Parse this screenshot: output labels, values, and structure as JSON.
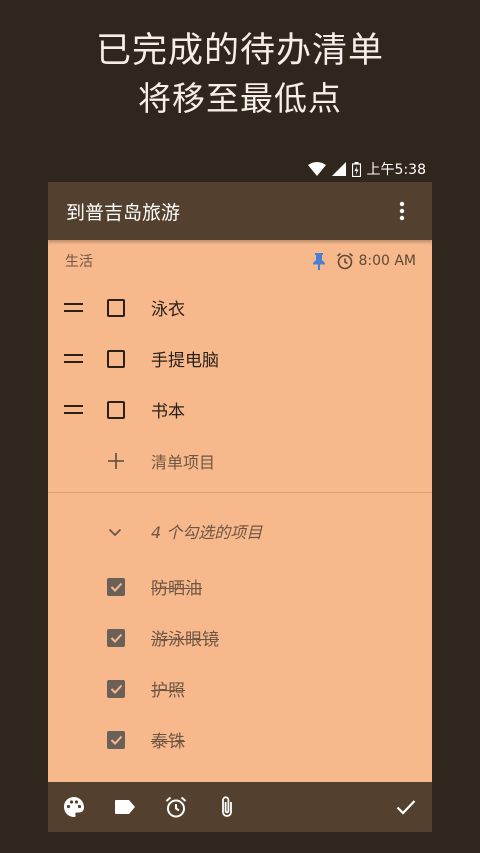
{
  "promo": {
    "line1": "已完成的待办清单",
    "line2": "将移至最低点"
  },
  "status_bar": {
    "time": "上午5:38"
  },
  "note": {
    "title": "到普吉岛旅游",
    "label": "生活",
    "reminder_time": "8:00 AM",
    "unchecked_items": [
      {
        "text": "泳衣"
      },
      {
        "text": "手提电脑"
      },
      {
        "text": "书本"
      }
    ],
    "add_item_placeholder": "清单项目",
    "checked_header": "4 个勾选的项目",
    "checked_items": [
      {
        "text": "防晒油"
      },
      {
        "text": "游泳眼镜"
      },
      {
        "text": "护照"
      },
      {
        "text": "泰铢"
      }
    ]
  },
  "colors": {
    "background": "#2f261d",
    "toolbar": "#53402f",
    "note": "#f7b88c",
    "pin_blue": "#4a7fd6"
  },
  "icons": {
    "toolbar": [
      "more-vert-icon"
    ],
    "meta": [
      "pin-icon",
      "alarm-icon"
    ],
    "bottom": [
      "palette-icon",
      "label-icon",
      "alarm-icon",
      "attachment-icon",
      "check-icon"
    ]
  }
}
